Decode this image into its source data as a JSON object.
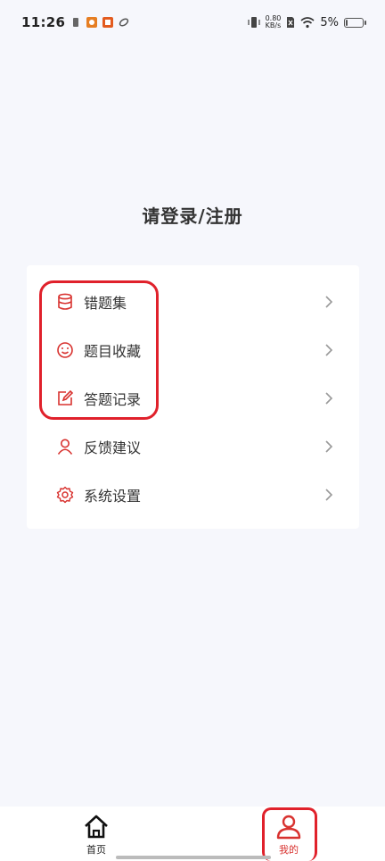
{
  "status_bar": {
    "time": "11:26",
    "net_speed_value": "0.80",
    "net_speed_unit": "KB/s",
    "battery_percent": "5%"
  },
  "login": {
    "title": "请登录/注册"
  },
  "menu": {
    "items": [
      {
        "label": "错题集",
        "icon": "database-icon"
      },
      {
        "label": "题目收藏",
        "icon": "smile-icon"
      },
      {
        "label": "答题记录",
        "icon": "edit-icon"
      },
      {
        "label": "反馈建议",
        "icon": "user-icon"
      },
      {
        "label": "系统设置",
        "icon": "gear-icon"
      }
    ]
  },
  "bottom_nav": {
    "home_label": "首页",
    "mine_label": "我的"
  },
  "colors": {
    "accent": "#d8322f",
    "highlight": "#e0212b",
    "background": "#f6f7fc"
  }
}
